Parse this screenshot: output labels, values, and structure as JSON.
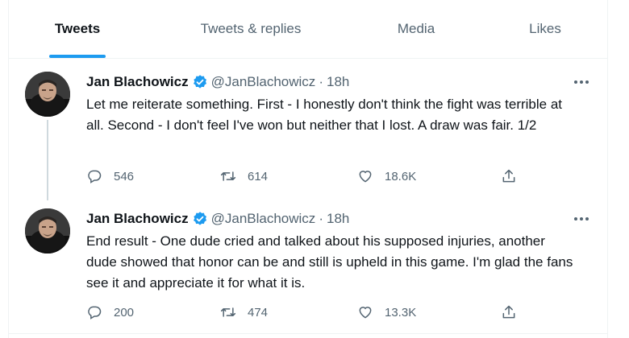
{
  "tabs": [
    {
      "label": "Tweets",
      "active": true
    },
    {
      "label": "Tweets & replies",
      "active": false
    },
    {
      "label": "Media",
      "active": false
    },
    {
      "label": "Likes",
      "active": false
    }
  ],
  "accent_color": "#1d9bf0",
  "tweets": [
    {
      "name": "Jan Blachowicz",
      "handle": "@JanBlachowicz",
      "separator": "·",
      "time": "18h",
      "text": "Let me reiterate something. First - I honestly don't think the fight was terrible at all. Second - I don't feel I've won but neither that I lost. A draw was fair. 1/2",
      "replies": "546",
      "retweets": "614",
      "likes": "18.6K"
    },
    {
      "name": "Jan Blachowicz",
      "handle": "@JanBlachowicz",
      "separator": "·",
      "time": "18h",
      "text": "End result - One dude cried and talked about his supposed injuries, another dude showed that honor can be and still is upheld in this game. I'm glad the fans see it and appreciate it for what it is.",
      "replies": "200",
      "retweets": "474",
      "likes": "13.3K"
    }
  ]
}
